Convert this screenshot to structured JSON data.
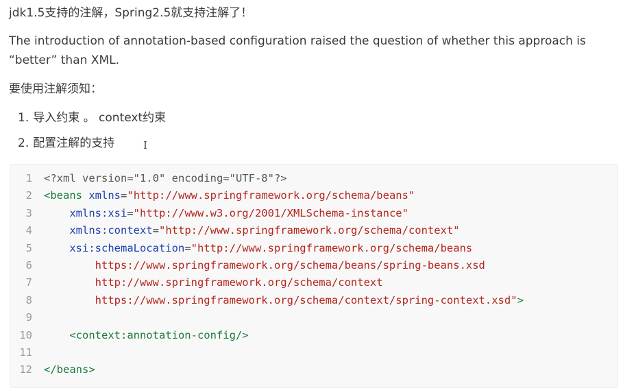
{
  "content": {
    "heading": "jdk1.5支持的注解，Spring2.5就支持注解了！",
    "intro": "The introduction of annotation-based configuration raised the question of whether this approach is “better” than XML.",
    "notice": "要使用注解须知：",
    "steps": [
      {
        "num": "1.",
        "text": "导入约束 。 context约束"
      },
      {
        "num": "2.",
        "text": "配置注解的支持"
      }
    ]
  },
  "code": {
    "language": "xml",
    "lines": [
      {
        "n": "1",
        "parts": [
          {
            "t": "<?xml version=\"1.0\" encoding=\"UTF-8\"?>",
            "c": "decl"
          }
        ]
      },
      {
        "n": "2",
        "parts": [
          {
            "t": "<beans",
            "c": "tag"
          },
          {
            "t": " ",
            "c": "pun"
          },
          {
            "t": "xmlns",
            "c": "attr"
          },
          {
            "t": "=",
            "c": "pun"
          },
          {
            "t": "\"http://www.springframework.org/schema/beans\"",
            "c": "str"
          }
        ]
      },
      {
        "n": "3",
        "parts": [
          {
            "t": "    ",
            "c": "pun"
          },
          {
            "t": "xmlns:xsi",
            "c": "attr"
          },
          {
            "t": "=",
            "c": "pun"
          },
          {
            "t": "\"http://www.w3.org/2001/XMLSchema-instance\"",
            "c": "str"
          }
        ]
      },
      {
        "n": "4",
        "parts": [
          {
            "t": "    ",
            "c": "pun"
          },
          {
            "t": "xmlns:context",
            "c": "attr"
          },
          {
            "t": "=",
            "c": "pun"
          },
          {
            "t": "\"http://www.springframework.org/schema/context\"",
            "c": "str"
          }
        ]
      },
      {
        "n": "5",
        "parts": [
          {
            "t": "    ",
            "c": "pun"
          },
          {
            "t": "xsi:schemaLocation",
            "c": "attr"
          },
          {
            "t": "=",
            "c": "pun"
          },
          {
            "t": "\"http://www.springframework.org/schema/beans",
            "c": "str"
          }
        ]
      },
      {
        "n": "6",
        "parts": [
          {
            "t": "        https://www.springframework.org/schema/beans/spring-beans.xsd",
            "c": "str"
          }
        ]
      },
      {
        "n": "7",
        "parts": [
          {
            "t": "        http://www.springframework.org/schema/context",
            "c": "str"
          }
        ]
      },
      {
        "n": "8",
        "parts": [
          {
            "t": "        https://www.springframework.org/schema/context/spring-context.xsd\"",
            "c": "str"
          },
          {
            "t": ">",
            "c": "tag"
          }
        ]
      },
      {
        "n": "9",
        "parts": []
      },
      {
        "n": "10",
        "parts": [
          {
            "t": "    ",
            "c": "pun"
          },
          {
            "t": "<context:annotation-config/>",
            "c": "tag"
          }
        ]
      },
      {
        "n": "11",
        "parts": []
      },
      {
        "n": "12",
        "parts": [
          {
            "t": "</beans>",
            "c": "tag"
          }
        ]
      }
    ]
  }
}
